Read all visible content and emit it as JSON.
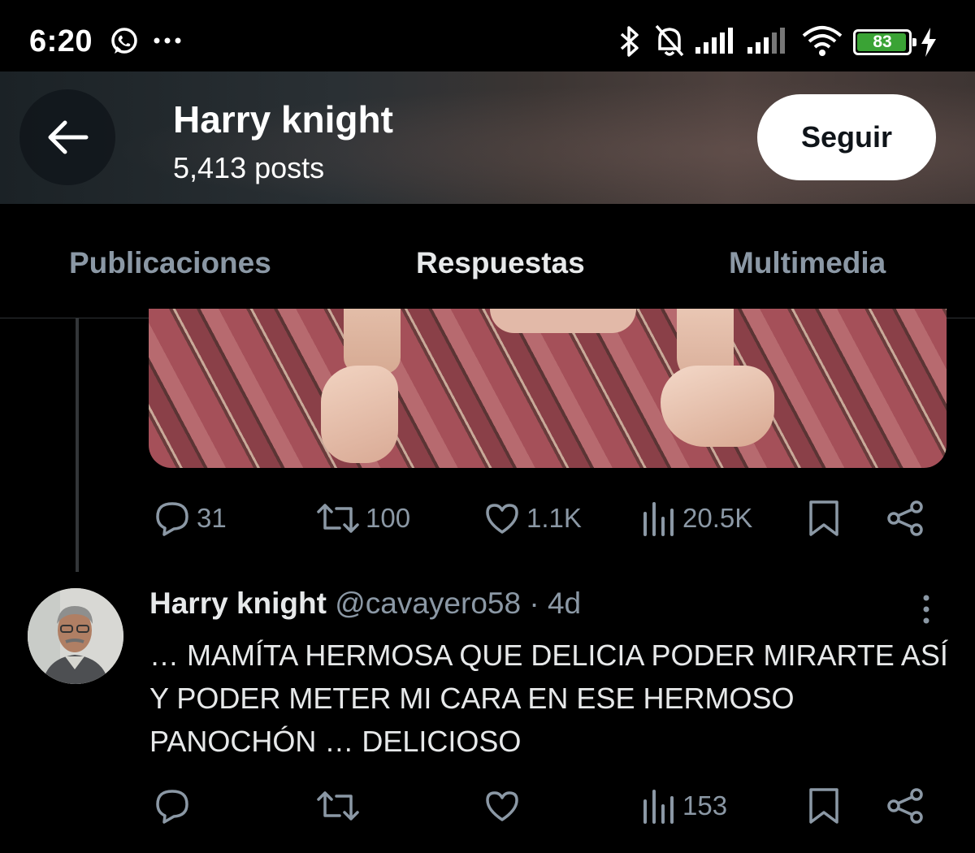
{
  "status_bar": {
    "time": "6:20",
    "battery_level": "83",
    "icons": [
      "whatsapp-icon",
      "more-notifications-icon",
      "bluetooth-icon",
      "mute-bell-icon",
      "signal-icon",
      "signal-icon",
      "wifi-icon",
      "battery-icon",
      "charging-icon"
    ]
  },
  "header": {
    "name": "Harry knight",
    "posts": "5,413 posts",
    "follow_label": "Seguir",
    "back_icon": "arrow-left-icon"
  },
  "tabs": [
    {
      "label": "Publicaciones",
      "active": false
    },
    {
      "label": "Respuestas",
      "active": true
    },
    {
      "label": "Multimedia",
      "active": false
    }
  ],
  "accent_color": "#1d9bf0",
  "post1": {
    "replies": "31",
    "reposts": "100",
    "likes": "1.1K",
    "views": "20.5K"
  },
  "post2": {
    "name": "Harry knight",
    "handle_time": "@cavayero58 · 4d",
    "text": "… MAMÍTA HERMOSA QUE DELICIA PODER MIRARTE ASÍ Y PODER METER MI CARA EN ESE HERMOSO PANOCHÓN … DELICIOSO",
    "views": "153"
  }
}
